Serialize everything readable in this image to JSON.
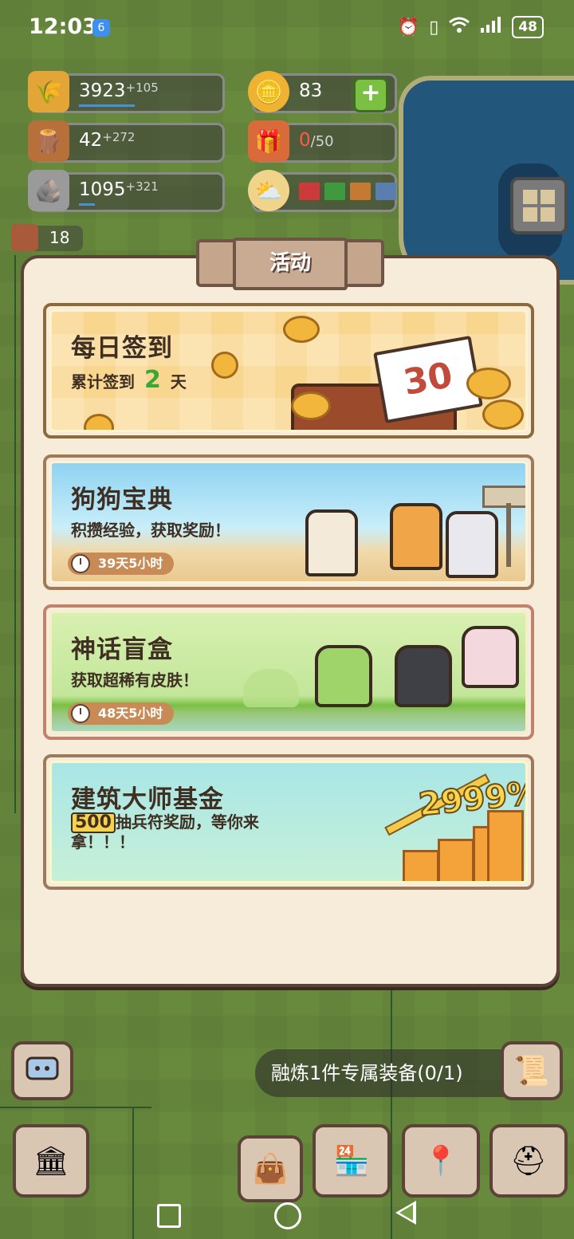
{
  "status_bar": {
    "time": "12:03",
    "notification_badge": "6",
    "battery": "48"
  },
  "resources": {
    "wheat": {
      "value": "3923",
      "increment": "+105"
    },
    "wood": {
      "value": "42",
      "increment": "+272"
    },
    "stone": {
      "value": "1095",
      "increment": "+321"
    },
    "gold": {
      "value": "83"
    },
    "gift": {
      "current": "0",
      "max": "/50"
    },
    "book_count": "18"
  },
  "weather_colors": [
    "#cc3b3b",
    "#3f9a3f",
    "#c57a34",
    "#5a7eb0"
  ],
  "modal": {
    "title": "活动",
    "cards": [
      {
        "title": "每日签到",
        "sub_prefix": "累计签到",
        "sub_value": "2",
        "sub_suffix": "天",
        "calendar_number": "30"
      },
      {
        "title": "狗狗宝典",
        "subtitle": "积攒经验，获取奖励！",
        "timer": "39天5小时"
      },
      {
        "title": "神话盲盒",
        "subtitle": "获取超稀有皮肤！",
        "timer": "48天5小时"
      },
      {
        "title": "建筑大师基金",
        "badge": "500",
        "desc_rest": "抽兵符奖励，等你来拿！！！",
        "percent": "2999%"
      }
    ]
  },
  "task_banner": "融炼1件专属装备(0/1)"
}
